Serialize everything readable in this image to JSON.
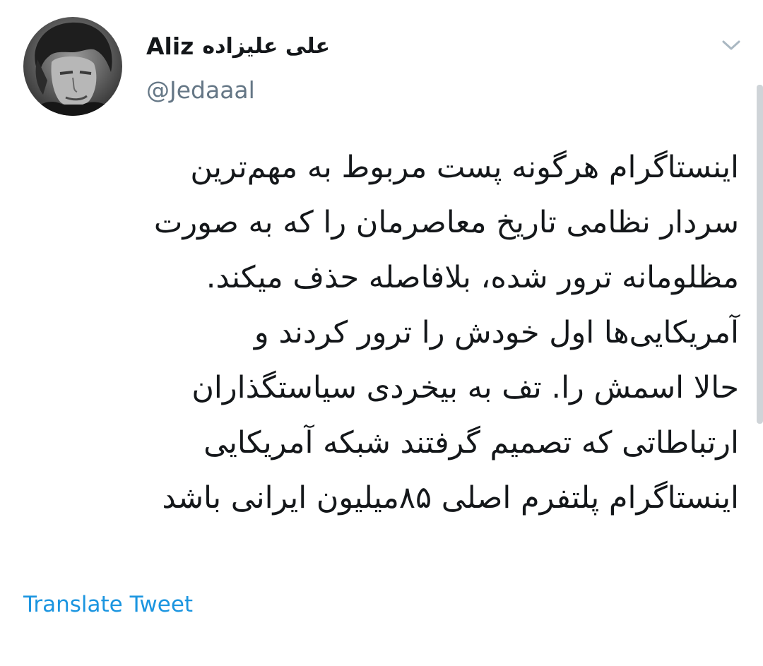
{
  "author": {
    "display_name_latin": "Aliz",
    "display_name_fa": "علی علیزاده",
    "handle": "@Jedaaal"
  },
  "tweet": {
    "lines": [
      "اینستاگرام هرگونه پست مربوط به مهم‌ترین",
      "سردار نظامی تاریخ معاصرمان را که به صورت",
      "مظلومانه ترور شده، بلافاصله حذف میکند.",
      "آمریکایی‌ها اول خودش را ترور کردند و",
      "حالا اسمش را. تف به بیخردی سیاستگذاران",
      "ارتباطاتی که تصمیم گرفتند شبکه آمریکایی",
      "اینستاگرام پلتفرم اصلی ۸۵میلیون ایرانی باشد"
    ]
  },
  "actions": {
    "translate_label": "Translate Tweet"
  },
  "icons": {
    "more": "chevron-down-icon",
    "avatar": "avatar"
  },
  "colors": {
    "text": "#14171a",
    "secondary": "#657786",
    "link": "#1b95e0",
    "chevron": "#aab8c2"
  }
}
